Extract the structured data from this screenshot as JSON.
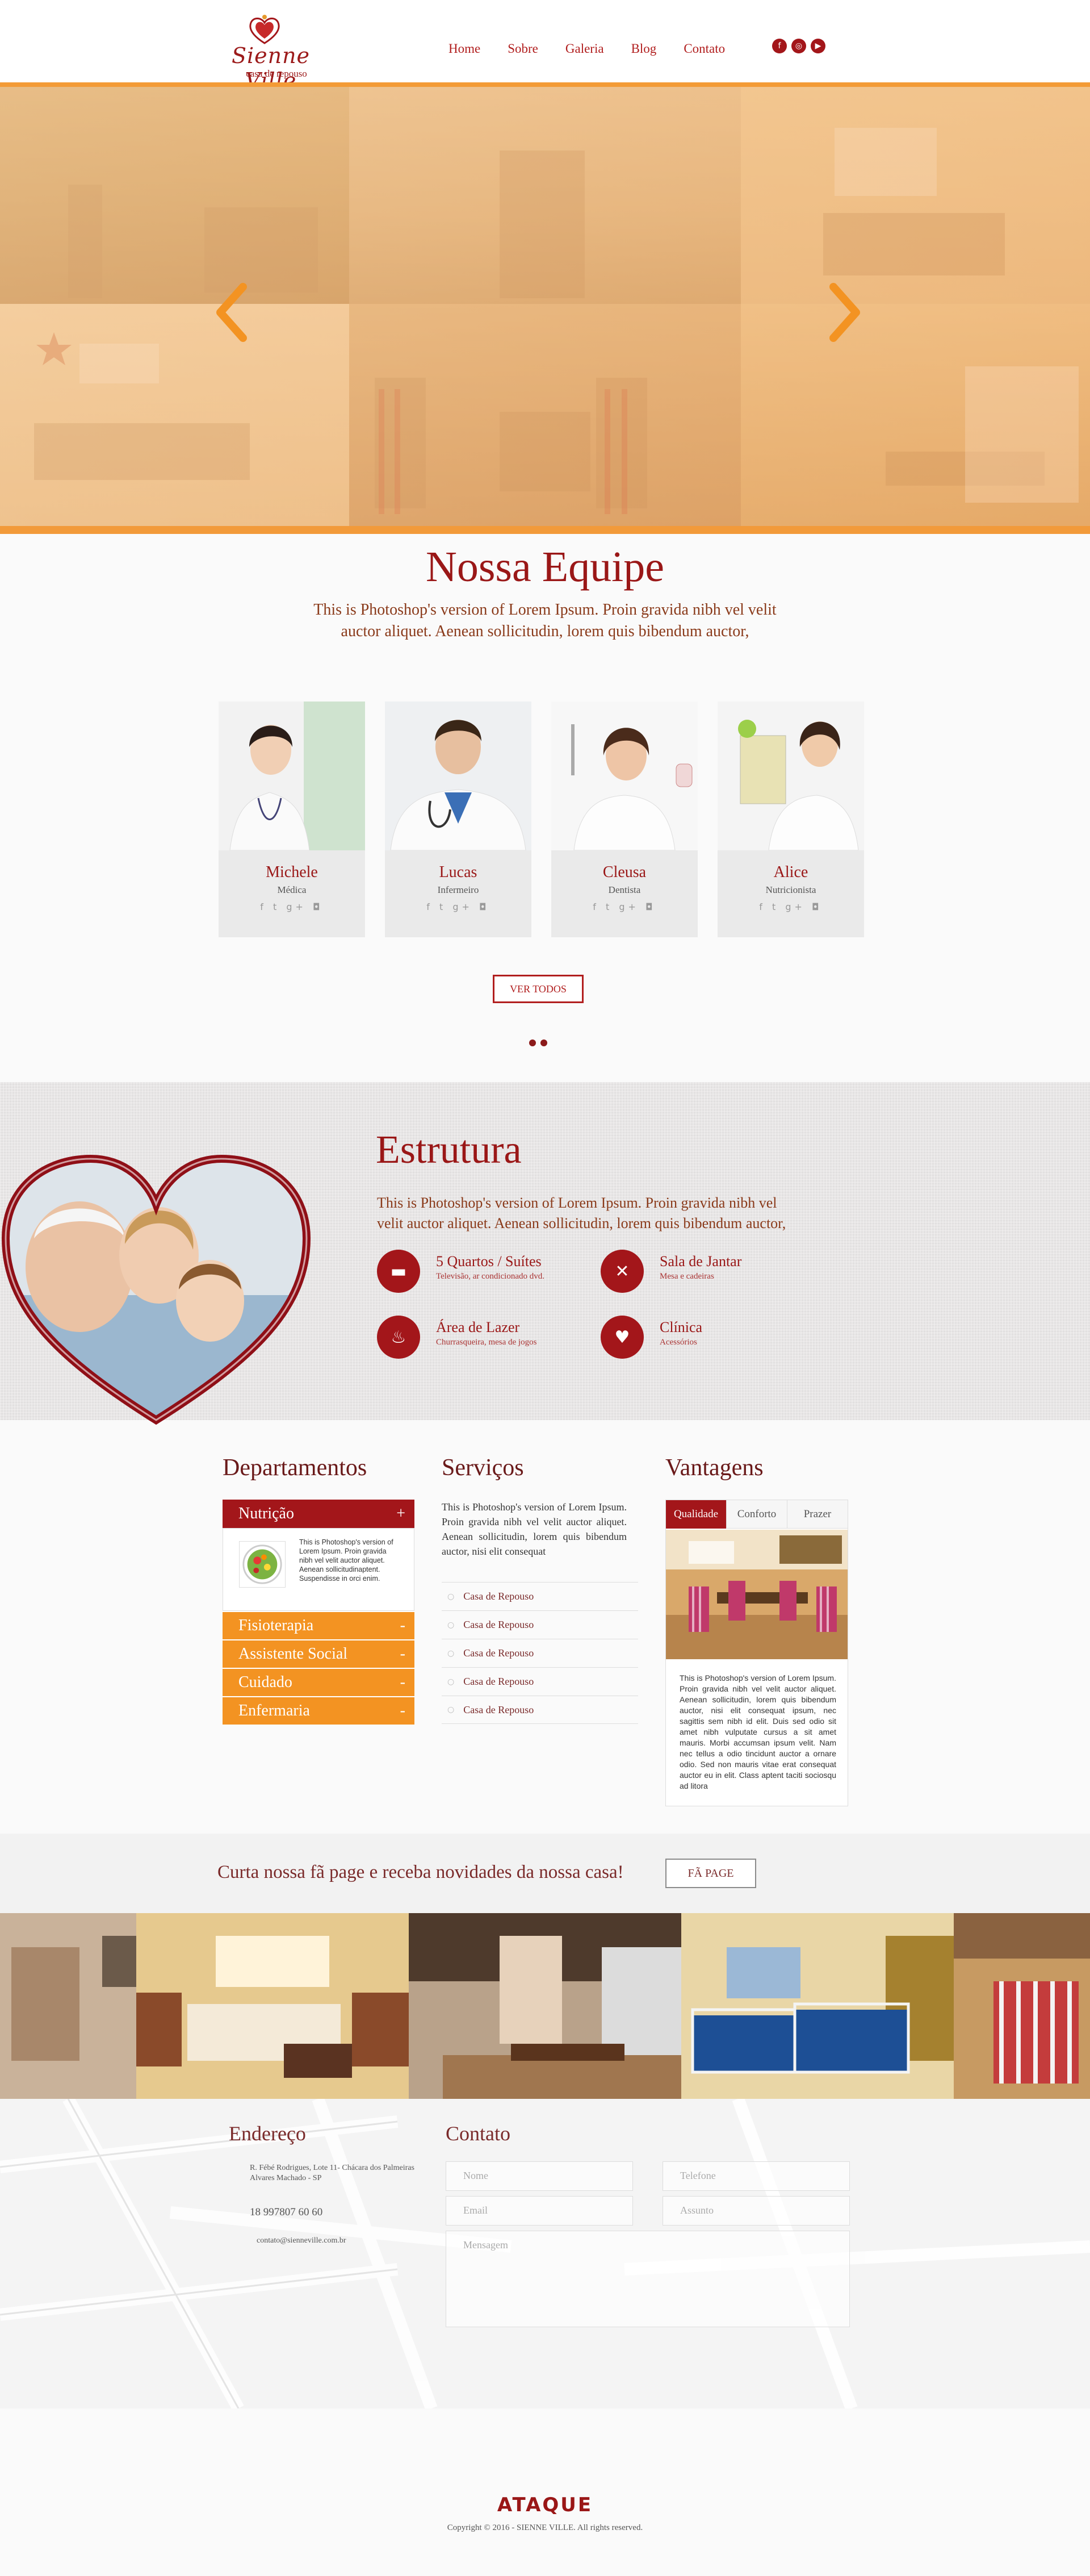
{
  "brand": {
    "name": "Sienne Ville",
    "tagline": "casa de repouso"
  },
  "nav": {
    "items": [
      "Home",
      "Sobre",
      "Galeria",
      "Blog",
      "Contato"
    ]
  },
  "social": [
    "f",
    "◎",
    "▶"
  ],
  "team": {
    "title": "Nossa Equipe",
    "description": "This is Photoshop's version  of Lorem Ipsum. Proin gravida nibh vel velit auctor aliquet. Aenean sollicitudin, lorem quis bibendum auctor,",
    "members": [
      {
        "name": "Michele",
        "role": "Médica"
      },
      {
        "name": "Lucas",
        "role": "Infermeiro"
      },
      {
        "name": "Cleusa",
        "role": "Dentista"
      },
      {
        "name": "Alice",
        "role": "Nutricionista"
      }
    ],
    "social_icons": "f t g+ ◘",
    "button": "VER TODOS"
  },
  "estrutura": {
    "title": "Estrutura",
    "description": "This is Photoshop's version  of Lorem Ipsum. Proin gravida nibh vel velit auctor aliquet. Aenean sollicitudin, lorem quis bibendum auctor,",
    "features": [
      {
        "title": "5 Quartos / Suítes",
        "sub": "Televisão, ar condicionado dvd.",
        "icon": "bed-icon",
        "glyph": "▬"
      },
      {
        "title": "Sala de Jantar",
        "sub": "Mesa e cadeiras",
        "icon": "cutlery-icon",
        "glyph": "✕"
      },
      {
        "title": "Área de Lazer",
        "sub": "Churrasqueira, mesa de jogos",
        "icon": "grill-icon",
        "glyph": "♨"
      },
      {
        "title": "Clínica",
        "sub": "Acessórios",
        "icon": "heart-pulse-icon",
        "glyph": "♥"
      }
    ]
  },
  "departamentos": {
    "title": "Departamentos",
    "open": {
      "label": "Nutrição",
      "toggle": "+",
      "text": "This is Photoshop's version  of Lorem Ipsum. Proin gravida nibh vel velit auctor aliquet. Aenean sollicitudinaptent. Suspendisse in orci enim."
    },
    "items": [
      {
        "label": "Fisioterapia",
        "toggle": "-"
      },
      {
        "label": "Assistente Social",
        "toggle": "-"
      },
      {
        "label": "Cuidado",
        "toggle": "-"
      },
      {
        "label": "Enfermaria",
        "toggle": "-"
      }
    ]
  },
  "servicos": {
    "title": "Serviços",
    "description": "This is Photoshop's version  of Lorem Ipsum. Proin gravida nibh vel velit auctor aliquet. Aenean sollicitudin, lorem quis bibendum auctor, nisi elit consequat",
    "items": [
      "Casa de Repouso",
      "Casa de Repouso",
      "Casa de Repouso",
      "Casa de Repouso",
      "Casa de Repouso"
    ],
    "bullet": "○"
  },
  "vantagens": {
    "title": "Vantagens",
    "tabs": [
      "Qualidade",
      "Conforto",
      "Prazer"
    ],
    "text": "This is Photoshop's version  of Lorem Ipsum. Proin gravida nibh vel velit auctor aliquet. Aenean sollicitudin, lorem quis bibendum auctor, nisi elit consequat ipsum, nec sagittis sem nibh id elit. Duis sed odio sit amet nibh vulputate cursus a sit amet mauris. Morbi accumsan ipsum velit. Nam nec tellus a odio tincidunt auctor a ornare odio. Sed non mauris vitae erat consequat auctor eu in elit. Class aptent taciti sociosqu ad litora"
  },
  "fanpage": {
    "text": "Curta nossa fã page e receba novidades da nossa casa!",
    "button": "FÃ PAGE"
  },
  "endereco": {
    "title": "Endereço",
    "address": "R. Fébé Rodrigues, Lote 11- Chácara dos Palmeiras Alvares Machado - SP",
    "phone": "18 997807 60 60",
    "email": "contato@sienneville.com.br"
  },
  "contato": {
    "title": "Contato",
    "placeholders": {
      "nome": "Nome",
      "telefone": "Telefone",
      "email": "Email",
      "assunto": "Assunto",
      "mensagem": "Mensagem"
    }
  },
  "footer": {
    "logo": "ATAQUE",
    "copyright": "Copyright © 2016 - SIENNE VILLE. All rights reserved."
  },
  "colors": {
    "brand_red": "#a3161a",
    "orange": "#f39322",
    "hero_tint": "#f4b46e"
  }
}
